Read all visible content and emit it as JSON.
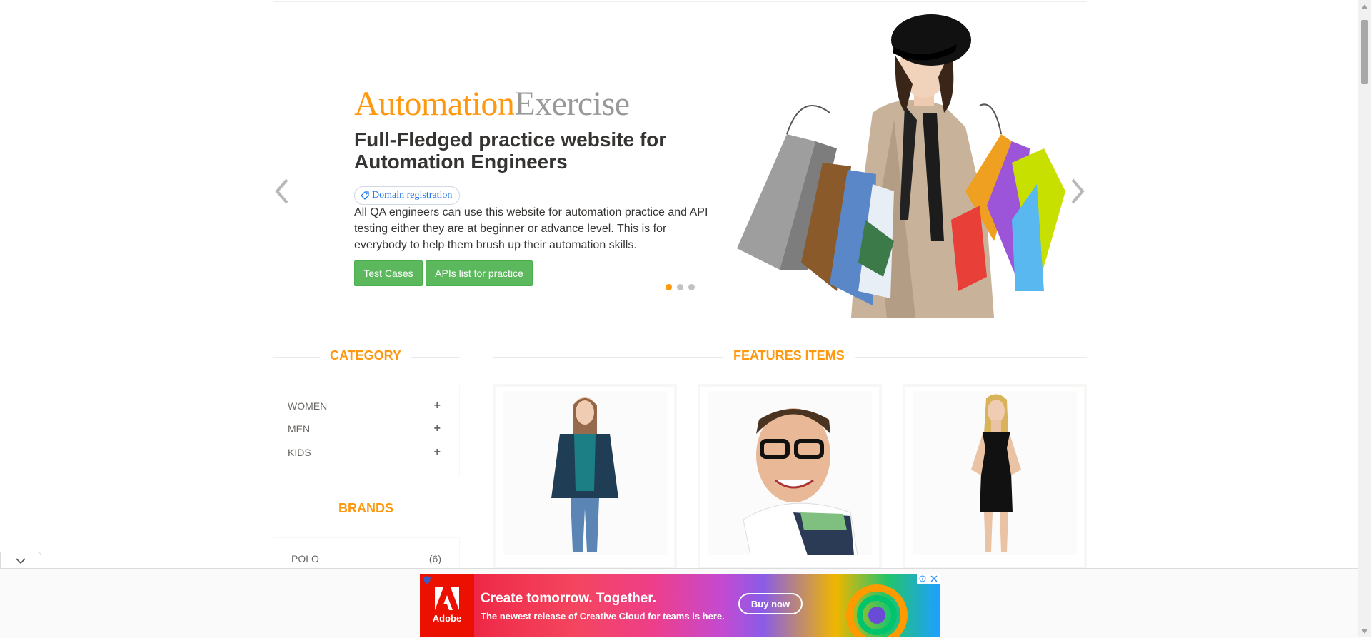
{
  "slider": {
    "brand_part1": "Automation",
    "brand_part2": "Exercise",
    "headline": "Full-Fledged practice website for Automation Engineers",
    "tag_label": "Domain registration",
    "description": "All QA engineers can use this website for automation practice and API testing either they are at beginner or advance level. This is for everybody to help them brush up their automation skills.",
    "buttons": [
      {
        "label": "Test Cases"
      },
      {
        "label": "APIs list for practice"
      }
    ],
    "active_slide": 1,
    "slide_count": 3
  },
  "sidebar": {
    "category_title": "CATEGORY",
    "categories": [
      {
        "label": "WOMEN"
      },
      {
        "label": "MEN"
      },
      {
        "label": "KIDS"
      }
    ],
    "brands_title": "BRANDS",
    "brands": [
      {
        "label": "POLO",
        "count": "(6)"
      }
    ]
  },
  "features": {
    "title": "FEATURES ITEMS"
  },
  "ad": {
    "brand": "Adobe",
    "headline": "Create tomorrow. Together.",
    "subline": "The newest release of Creative Cloud for teams is here.",
    "cta": "Buy now"
  },
  "colors": {
    "accent": "#FE980F",
    "button_green": "#5cb85c",
    "ad_red": "#eb1000"
  },
  "icons": [
    "chevron-left-icon",
    "chevron-right-icon",
    "tag-icon",
    "plus-icon",
    "chevron-down-icon",
    "adchoices-icon",
    "close-icon",
    "shield-icon"
  ]
}
